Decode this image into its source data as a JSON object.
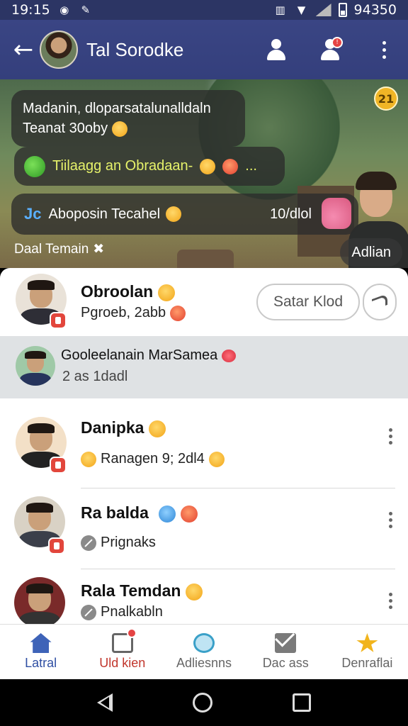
{
  "status_bar": {
    "time": "19:15",
    "battery_text": "94350",
    "icons": [
      "wechat-icon",
      "tools-icon",
      "vibrate-icon",
      "wifi-icon",
      "signal-icon",
      "battery-icon"
    ]
  },
  "app_bar": {
    "title": "Tal Sorodke",
    "back_icon": "arrow-left-icon",
    "actions": [
      {
        "name": "contacts-icon"
      },
      {
        "name": "add-contact-icon",
        "badge": "!"
      },
      {
        "name": "more-vert-icon"
      }
    ]
  },
  "hero": {
    "corner_badge": "21",
    "bubbles": [
      {
        "text": "Madanin, dloparsatalunalldaln Teanat 30oby"
      },
      {
        "text": "Tiilaagg an Obradaan-",
        "suffix": "..."
      },
      {
        "prefix": "Jc",
        "text": "Aboposin Tecahel",
        "time": "10/dlol"
      }
    ],
    "footer_left": "Daal Temain",
    "footer_right": "Adlian"
  },
  "conversations": [
    {
      "name": "Obroolan",
      "subtitle": "Pgroeb, 2abb",
      "button": "Satar Klod"
    },
    {
      "name": "Gooleelanain MarSamea",
      "subtitle": "2 as 1dadl",
      "highlighted": true
    },
    {
      "name": "Danipka",
      "subtitle": "Ranagen 9; 2dl4"
    },
    {
      "name": "Ra balda",
      "subtitle": "Prignaks"
    },
    {
      "name": "Rala Temdan",
      "subtitle": "Pnalkabln"
    }
  ],
  "bottom_nav": [
    {
      "label": "Latral",
      "icon": "home-icon",
      "active": true
    },
    {
      "label": "Uld kien",
      "icon": "photo-frame-icon"
    },
    {
      "label": "Adliesnns",
      "icon": "chat-bubble-icon"
    },
    {
      "label": "Dac ass",
      "icon": "mail-icon"
    },
    {
      "label": "Denraflai",
      "icon": "star-icon"
    }
  ],
  "colors": {
    "app_bar": "#3a4584",
    "accent": "#2f4fa3",
    "alert": "#c1362c",
    "highlight_row": "#dfe2e4"
  }
}
